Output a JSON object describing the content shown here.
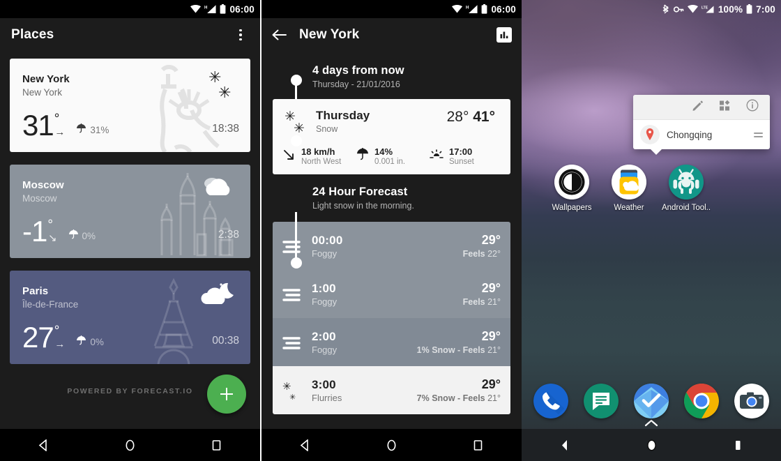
{
  "screens": {
    "places": {
      "status": {
        "time": "06:00",
        "icons": [
          "wifi-icon",
          "signal-h-icon",
          "battery-icon"
        ]
      },
      "appbar": {
        "title": "Places",
        "overflow_icon": "kebab-menu-icon"
      },
      "cards": [
        {
          "city": "New York",
          "region": "New York",
          "temp": "31",
          "degree": "°",
          "trend_icon": "arrow-right-icon",
          "trend": "→",
          "rain_icon": "umbrella-icon",
          "rain": "31%",
          "time": "18:38",
          "condition_icon": "snow-icon",
          "art": "statue-of-liberty",
          "theme": "light",
          "bg": "#fafafa"
        },
        {
          "city": "Moscow",
          "region": "Moscow",
          "temp": "-1",
          "degree": "°",
          "trend_icon": "arrow-down-right-icon",
          "trend": "↘",
          "rain_icon": "umbrella-icon",
          "rain": "0%",
          "time": "2:38",
          "condition_icon": "cloudy-icon",
          "art": "saint-basil-cathedral",
          "theme": "grey",
          "bg": "#8b939c"
        },
        {
          "city": "Paris",
          "region": "Île-de-France",
          "temp": "27",
          "degree": "°",
          "trend_icon": "arrow-right-icon",
          "trend": "→",
          "rain_icon": "umbrella-icon",
          "rain": "0%",
          "time": "00:38",
          "condition_icon": "partly-cloudy-night-icon",
          "art": "eiffel-tower",
          "theme": "purple",
          "bg": "#545b80"
        }
      ],
      "footer": {
        "powered_by": "POWERED BY FORECAST.IO",
        "fab_icon": "plus-icon",
        "fab_color": "#4caf50"
      },
      "nav": [
        "back-icon",
        "home-icon",
        "recents-icon"
      ]
    },
    "detail": {
      "status": {
        "time": "06:00",
        "icons": [
          "wifi-icon",
          "signal-h-icon",
          "battery-icon"
        ]
      },
      "appbar": {
        "back_icon": "back-arrow-icon",
        "title": "New York",
        "action_icon": "bar-chart-icon"
      },
      "timeline_head": {
        "title": "4 days from now",
        "subtitle": "Thursday - 21/01/2016"
      },
      "day_card": {
        "condition_icon": "snow-icon",
        "day": "Thursday",
        "summary": "Snow",
        "low": "28°",
        "high": "41°",
        "metrics": [
          {
            "icon": "wind-arrow-icon",
            "value": "18 km/h",
            "label": "North West"
          },
          {
            "icon": "umbrella-icon",
            "value": "14%",
            "label": "0.001 in."
          },
          {
            "icon": "sunset-icon",
            "value": "17:00",
            "label": "Sunset"
          }
        ]
      },
      "forecast_head": {
        "title": "24 Hour Forecast",
        "subtitle": "Light snow in the morning."
      },
      "hours": [
        {
          "icon": "fog-icon",
          "time": "00:00",
          "desc": "Foggy",
          "temp": "29°",
          "feels_prefix": "Feels ",
          "feels": "22°",
          "precip": "",
          "theme": "g1"
        },
        {
          "icon": "fog-icon",
          "time": "1:00",
          "desc": "Foggy",
          "temp": "29°",
          "feels_prefix": "Feels ",
          "feels": "21°",
          "precip": "",
          "theme": "g1"
        },
        {
          "icon": "fog-icon",
          "time": "2:00",
          "desc": "Foggy",
          "temp": "29°",
          "feels_prefix": "Feels ",
          "feels": "21°",
          "precip": "1% Snow - ",
          "theme": "g2"
        },
        {
          "icon": "flurries-icon",
          "time": "3:00",
          "desc": "Flurries",
          "temp": "29°",
          "feels_prefix": "Feels ",
          "feels": "21°",
          "precip": "7% Snow - ",
          "theme": "light"
        }
      ],
      "nav": [
        "back-icon",
        "home-icon",
        "recents-icon"
      ]
    },
    "home": {
      "status": {
        "battery_pct": "100%",
        "time": "7:00",
        "icons": [
          "bluetooth-icon",
          "vpn-key-icon",
          "wifi-icon",
          "signal-lte-icon",
          "battery-icon"
        ]
      },
      "popup": {
        "tools": [
          "edit-pencil-icon",
          "widget-icon",
          "info-icon"
        ],
        "location_icon": "map-pin-icon",
        "location_name": "Chongqing",
        "drag_handle_icon": "drag-handle-icon"
      },
      "apps": [
        {
          "label": "Wallpapers",
          "icon": "wallpapers-app-icon"
        },
        {
          "label": "Weather",
          "icon": "weather-app-icon"
        },
        {
          "label": "Android Tool..",
          "icon": "android-tools-app-icon"
        }
      ],
      "dock": [
        {
          "label": "Phone",
          "icon": "phone-app-icon"
        },
        {
          "label": "Messages",
          "icon": "messages-app-icon"
        },
        {
          "label": "Tasks",
          "icon": "tasks-app-icon"
        },
        {
          "label": "Chrome",
          "icon": "chrome-app-icon"
        },
        {
          "label": "Camera",
          "icon": "camera-app-icon"
        }
      ],
      "drawer_handle_icon": "chevron-up-icon",
      "nav": [
        "back-icon",
        "home-icon",
        "recents-icon"
      ]
    }
  }
}
